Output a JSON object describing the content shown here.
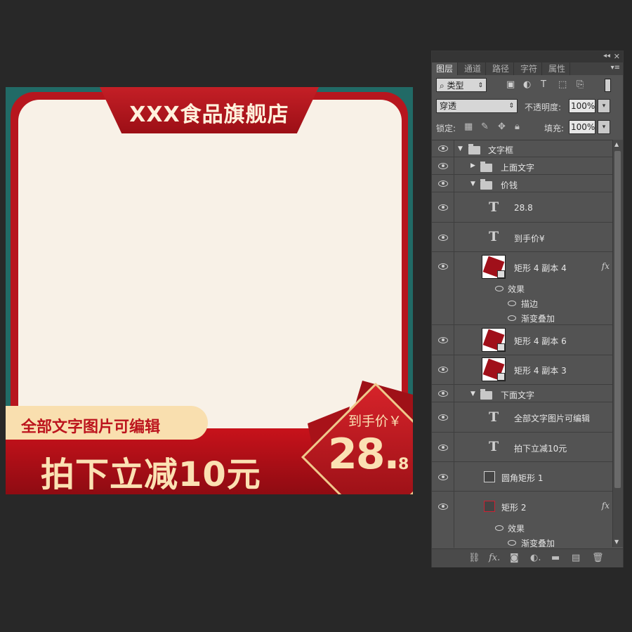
{
  "canvas": {
    "store_title": "XXX食品旗舰店",
    "promo_pill": "全部文字图片可编辑",
    "promo_main": "拍下立减10元",
    "price_label": "到手价￥",
    "price_whole": "28.",
    "price_decimal": "8"
  },
  "panel": {
    "tabs": [
      "图层",
      "通道",
      "路径",
      "字符",
      "属性"
    ],
    "active_tab": "图层",
    "filter_kind": "类型",
    "blend_mode": "穿透",
    "opacity_label": "不透明度:",
    "opacity_value": "100%",
    "lock_label": "锁定:",
    "fill_label": "填充:",
    "fill_value": "100%"
  },
  "layers": {
    "group_textframe": "文字框",
    "group_top_text": "上面文字",
    "group_price": "价钱",
    "text_price": "28.8",
    "text_price_label": "到手价¥",
    "shape_rect4_copy4": "矩形 4 副本 4",
    "effects_label": "效果",
    "effect_stroke": "描边",
    "effect_gradient": "渐变叠加",
    "shape_rect4_copy6": "矩形 4 副本 6",
    "shape_rect4_copy3": "矩形 4 副本 3",
    "group_bottom_text": "下面文字",
    "text_editable": "全部文字图片可编辑",
    "text_discount": "拍下立减10元",
    "shape_rounded_rect": "圆角矩形 1",
    "shape_rect2": "矩形 2",
    "effects_label2": "效果",
    "effect_gradient2": "渐变叠加",
    "fx_label": "fx"
  },
  "colors": {
    "canvas_teal": "#216a66",
    "canvas_red": "#b7161e",
    "canvas_cream": "#f8f1e7",
    "canvas_gold": "#fbe1b3",
    "panel_bg": "#535353"
  }
}
